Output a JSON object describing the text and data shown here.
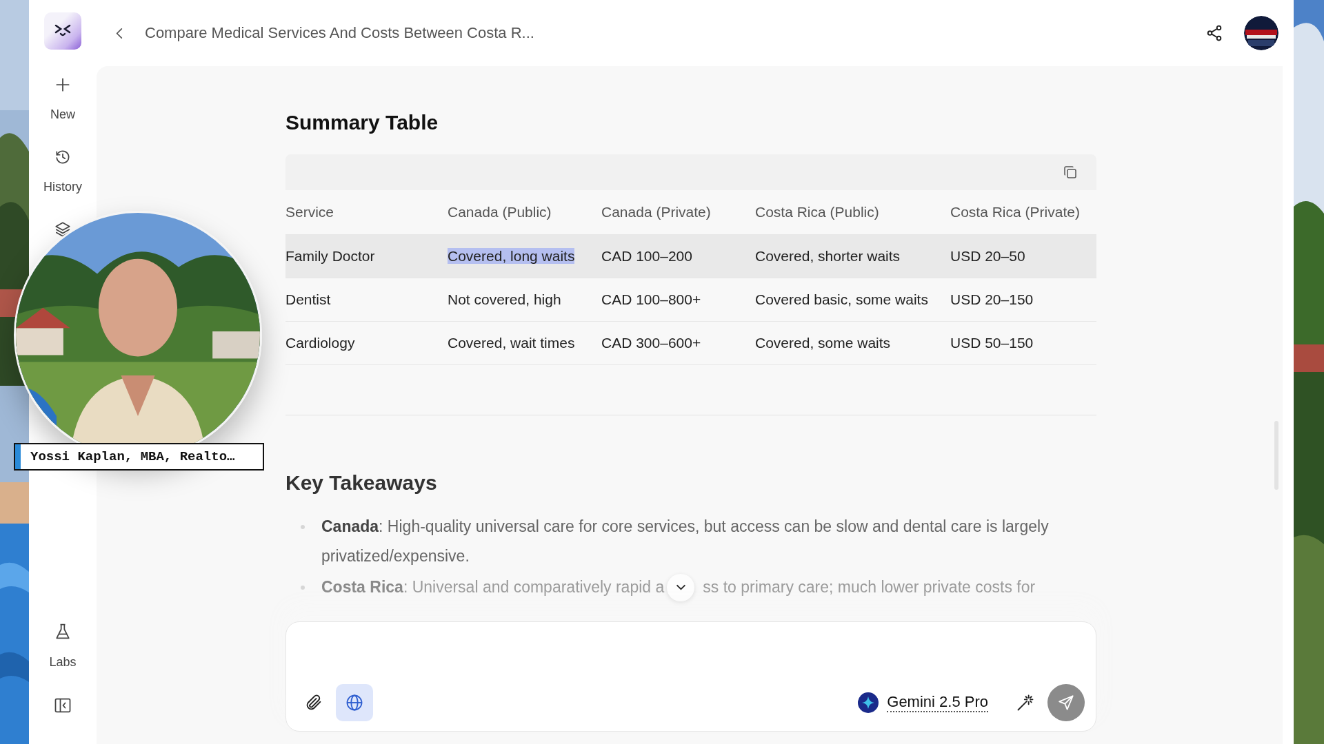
{
  "window": {
    "title": "Compare Medical Services And Costs Between Costa R..."
  },
  "sidebar": {
    "items": [
      {
        "kind": "plus",
        "label": "New"
      },
      {
        "kind": "history",
        "label": "History"
      },
      {
        "kind": "layers"
      }
    ],
    "bottom_items": [
      {
        "kind": "flask",
        "label": "Labs"
      },
      {
        "kind": "collapse"
      }
    ]
  },
  "video_overlay": {
    "kind": "picture",
    "caption": "Yossi Kaplan, MBA, Realto…"
  },
  "summary": {
    "heading": "Summary Table",
    "table": {
      "columns": [
        "Service",
        "Canada (Public)",
        "Canada (Private)",
        "Costa Rica (Public)",
        "Costa Rica (Private)"
      ],
      "rows": [
        {
          "hover": true,
          "cells": [
            {
              "text": "Family Doctor",
              "selected": false
            },
            {
              "text": "Covered, long waits",
              "selected": true
            },
            {
              "text": "CAD 100–200",
              "selected": false
            },
            {
              "text": "Covered, shorter waits",
              "selected": false
            },
            {
              "text": "USD 20–50",
              "selected": false
            }
          ]
        },
        {
          "hover": false,
          "cells": [
            {
              "text": "Dentist",
              "selected": false
            },
            {
              "text": "Not covered, high",
              "selected": false
            },
            {
              "text": "CAD 100–800+",
              "selected": false
            },
            {
              "text": "Covered basic, some waits",
              "selected": false
            },
            {
              "text": "USD 20–150",
              "selected": false
            }
          ]
        },
        {
          "hover": false,
          "cells": [
            {
              "text": "Cardiology",
              "selected": false
            },
            {
              "text": "Covered, wait times",
              "selected": false
            },
            {
              "text": "CAD 300–600+",
              "selected": false
            },
            {
              "text": "Covered, some waits",
              "selected": false
            },
            {
              "text": "USD 50–150",
              "selected": false
            }
          ]
        }
      ]
    }
  },
  "takeaways": {
    "heading": "Key Takeaways",
    "items": [
      {
        "term": "Canada",
        "text": ": High-quality universal care for core services, but access can be slow and dental care is largely privatized/expensive."
      },
      {
        "term": "Costa Rica",
        "text": ": Universal and comparatively rapid a",
        "text_after": "ss to primary care; much lower private costs for"
      }
    ]
  },
  "composer": {
    "web_search_on": true,
    "model": "Gemini 2.5 Pro"
  }
}
